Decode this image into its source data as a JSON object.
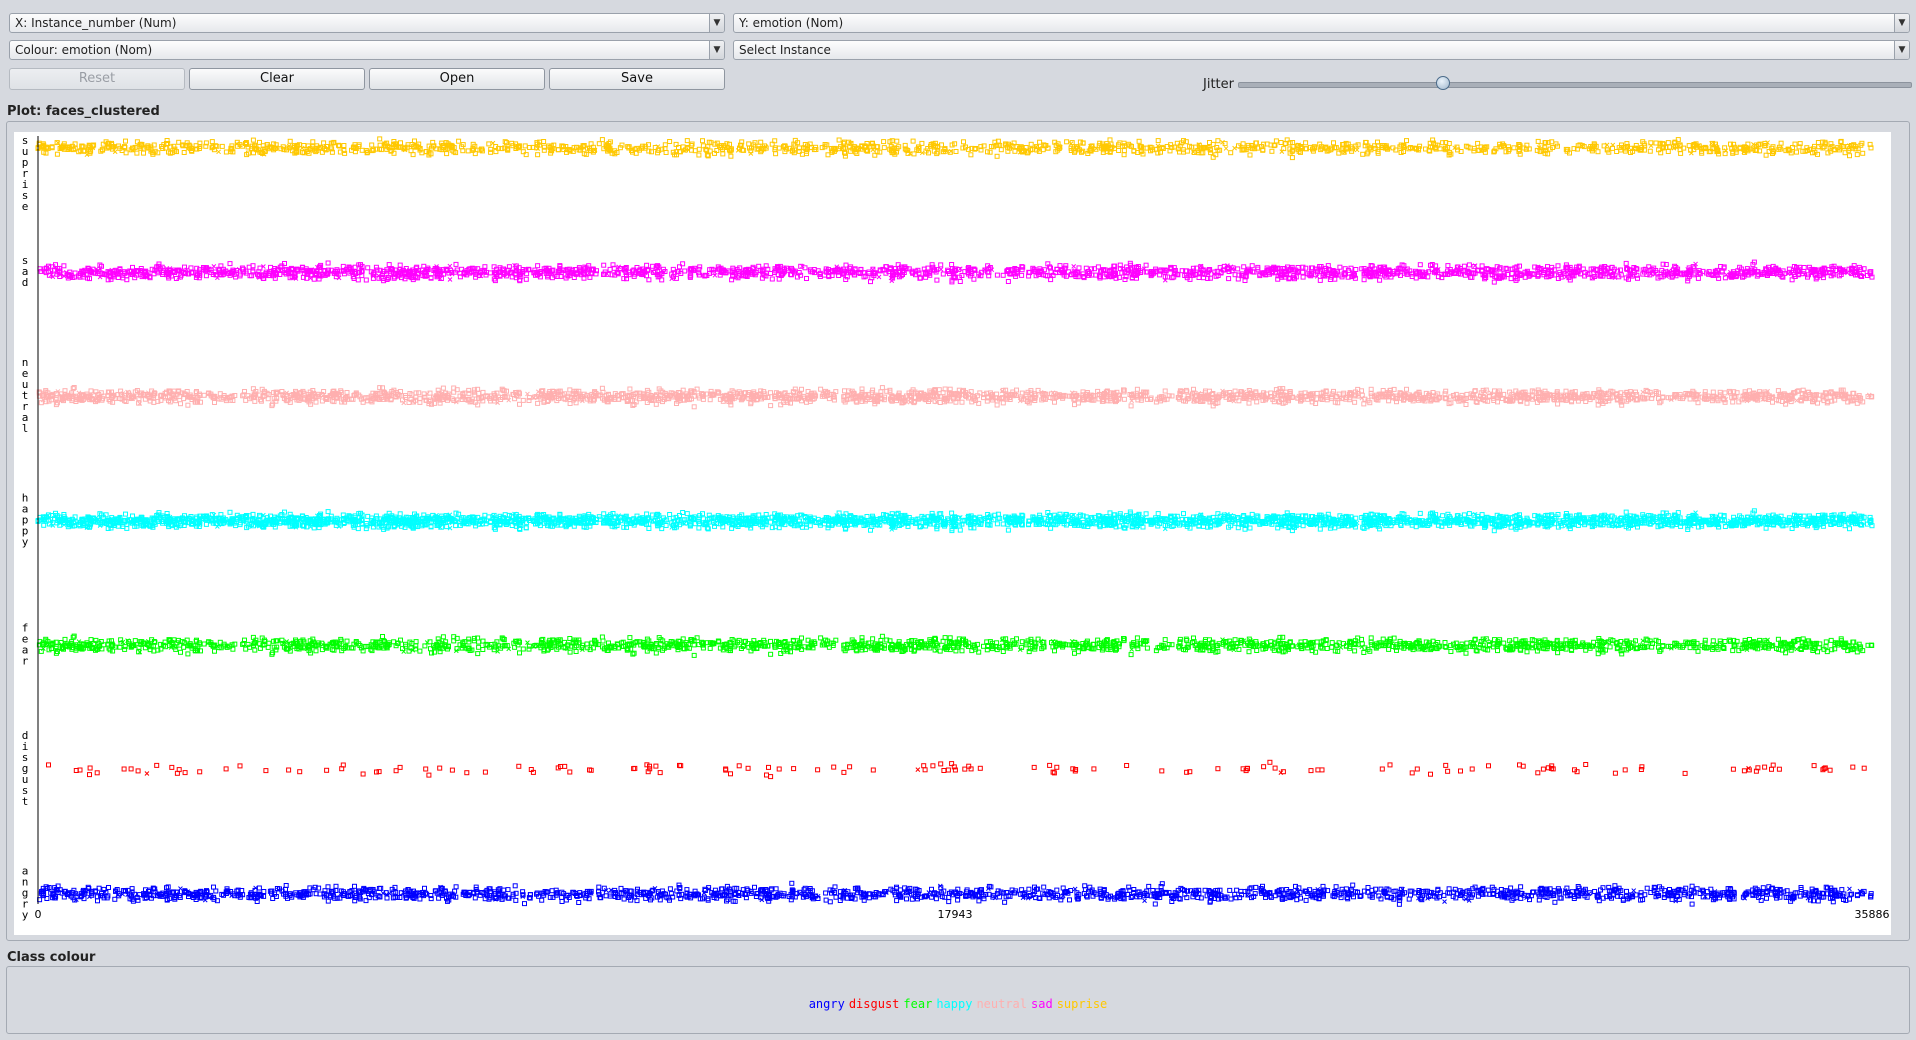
{
  "controls": {
    "x_axis": "X: Instance_number (Num)",
    "y_axis": "Y: emotion (Nom)",
    "colour": "Colour: emotion (Nom)",
    "select_instance": "Select Instance",
    "reset": "Reset",
    "clear": "Clear",
    "open": "Open",
    "save": "Save",
    "jitter_label": "Jitter",
    "jitter_value": 0.25
  },
  "plot_title": "Plot: faces_clustered",
  "class_colour_title": "Class colour",
  "chart_data": {
    "type": "scatter",
    "title": "",
    "xlabel": "Instance_number",
    "ylabel": "emotion",
    "xlim": [
      0,
      35886
    ],
    "x_ticks": [
      "0",
      "17943",
      "35886"
    ],
    "categories": [
      "angry",
      "disgust",
      "fear",
      "happy",
      "neutral",
      "sad",
      "suprise"
    ],
    "series": [
      {
        "name": "angry",
        "color": "#0000ff",
        "approx_count": 4953
      },
      {
        "name": "disgust",
        "color": "#ff0000",
        "approx_count": 547
      },
      {
        "name": "fear",
        "color": "#00ff00",
        "approx_count": 5121
      },
      {
        "name": "happy",
        "color": "#00ffff",
        "approx_count": 8989
      },
      {
        "name": "neutral",
        "color": "#ffafaf",
        "approx_count": 6198
      },
      {
        "name": "sad",
        "color": "#ff00ff",
        "approx_count": 6077
      },
      {
        "name": "suprise",
        "color": "#ffc800",
        "approx_count": 4002
      }
    ],
    "jitter": true,
    "markers": [
      "square",
      "x"
    ],
    "grid": false
  }
}
